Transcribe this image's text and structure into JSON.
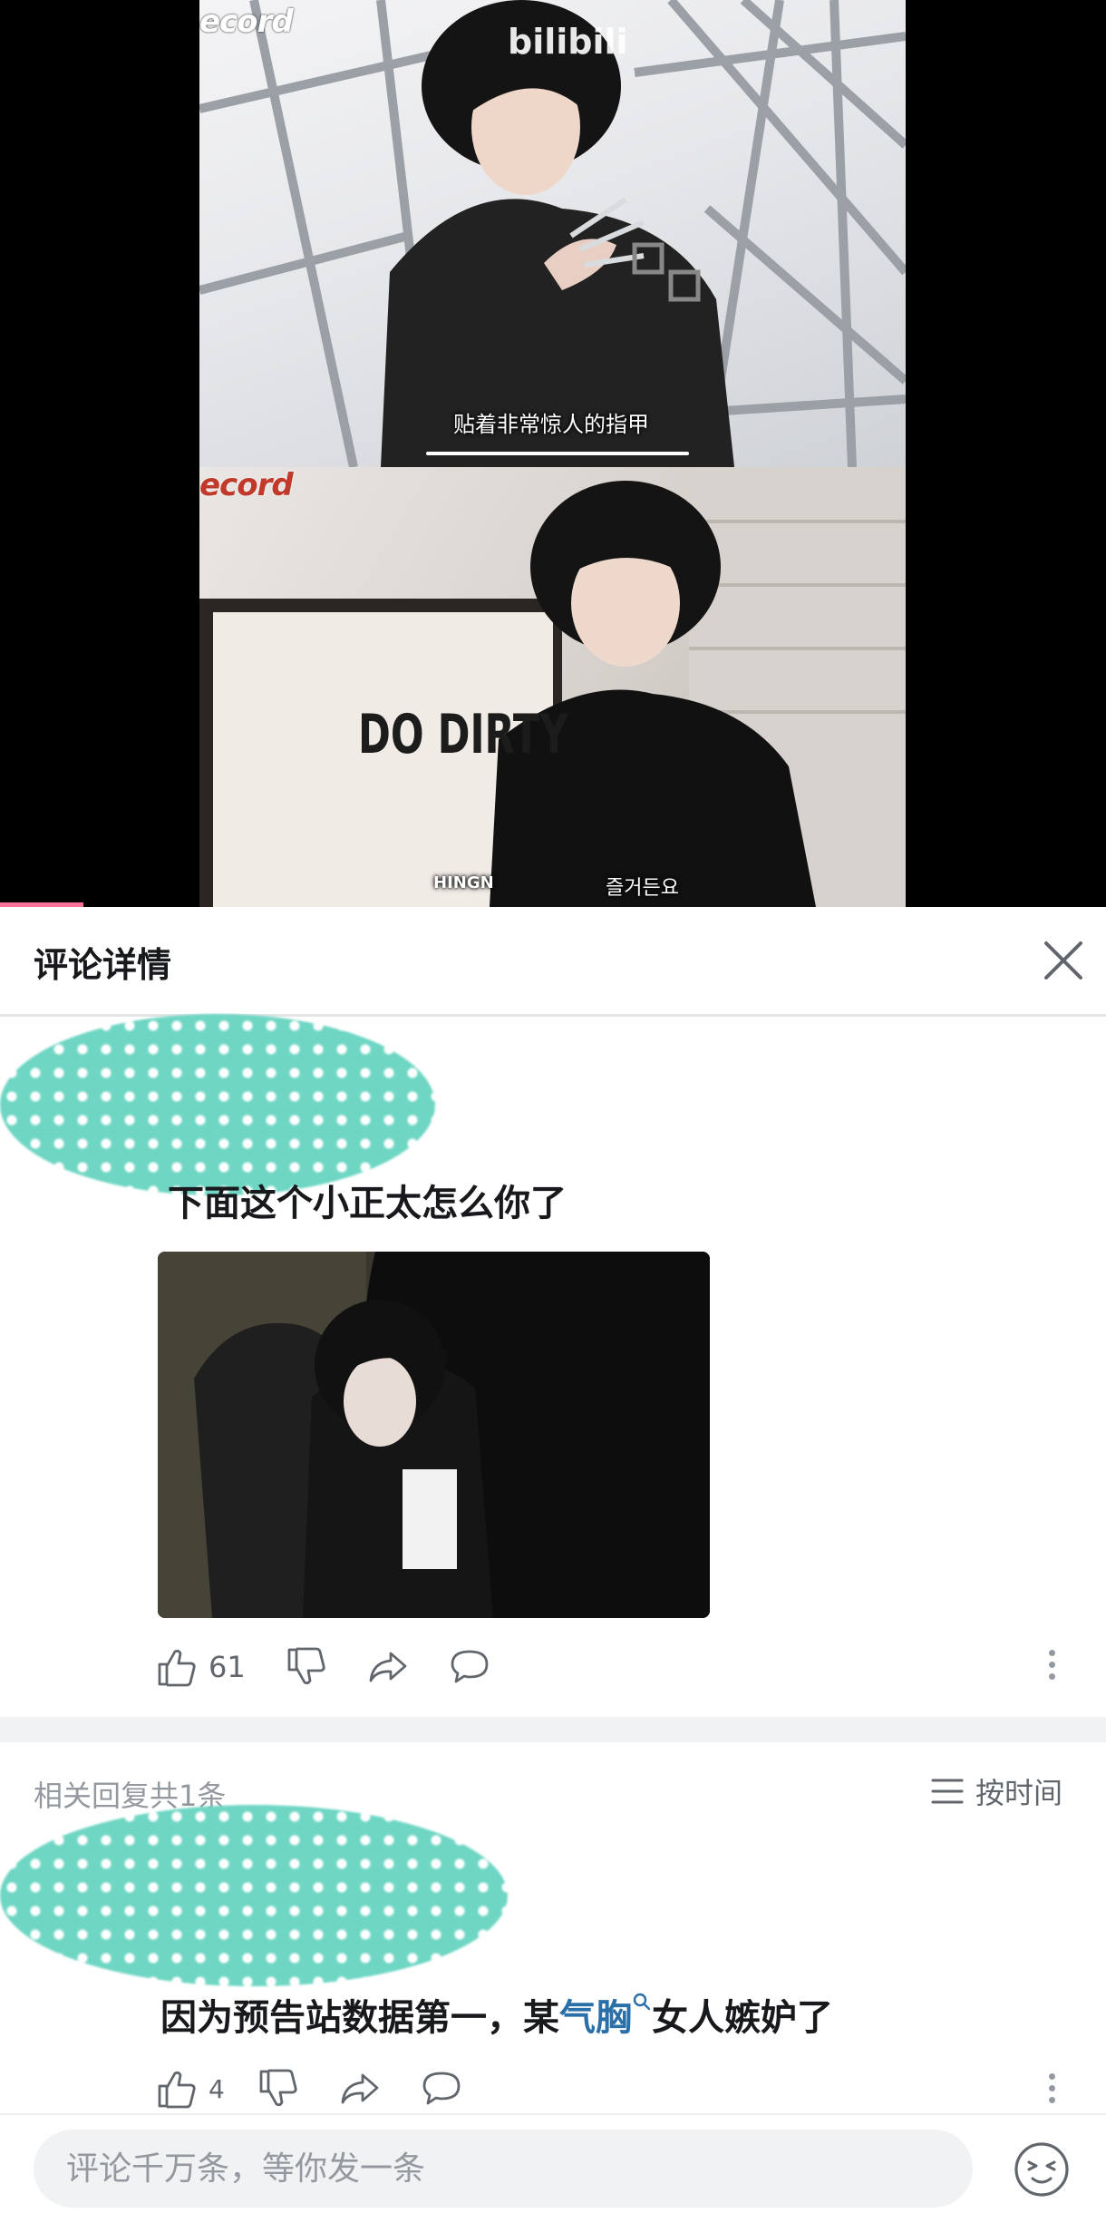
{
  "video": {
    "watermark_top": "ecord",
    "watermark_mid": "ecord",
    "brand": "bilibili",
    "subtitle_1": "贴着非常惊人的指甲",
    "subtitle_2": "HINGN",
    "subtitle_2b": "즐거든요",
    "shirt_text": "DO DIRTY"
  },
  "header": {
    "title": "评论详情",
    "close_icon": "close-icon"
  },
  "main_comment": {
    "text": "下面这个小正太怎么你了",
    "likes": "61",
    "icons": [
      "thumb-up-icon",
      "thumb-down-icon",
      "share-icon",
      "reply-icon",
      "more-icon"
    ]
  },
  "replies": {
    "count_label": "相关回复共1条",
    "sort_label": "按时间"
  },
  "reply_comment": {
    "text_before": "因为预告站数据第一，某",
    "keyword": "气胸",
    "text_after": "女人嫉妒了",
    "likes": "4"
  },
  "input": {
    "placeholder": "评论千万条，等你发一条"
  },
  "colors": {
    "accent_pink": "#fb7299",
    "keyword_blue": "#2b6fa8",
    "blur_teal": "#6fd6c4"
  }
}
